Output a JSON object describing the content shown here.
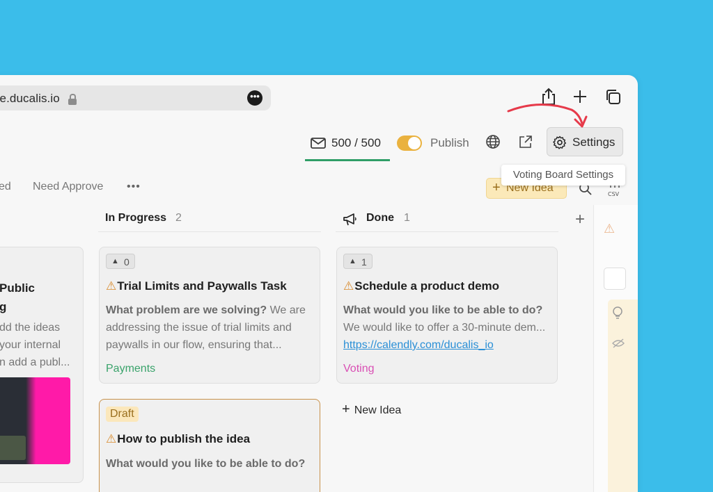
{
  "browser": {
    "url": "ge.ducalis.io",
    "menu_dots": "•••"
  },
  "toolbar": {
    "mail_count": "500 / 500",
    "publish_label": "Publish",
    "settings_label": "Settings",
    "tooltip": "Voting Board Settings"
  },
  "tabs": [
    {
      "label": "ved"
    },
    {
      "label": "Need Approve"
    }
  ],
  "tabs_more": "•••",
  "new_idea_top": "New Idea",
  "columns": {
    "left_partial": {
      "title_line1": "Public",
      "title_line2": "g",
      "desc_line1": "dd the ideas",
      "desc_line2": "your internal",
      "desc_line3": "n add a publ..."
    },
    "in_progress": {
      "title": "In Progress",
      "count": "2",
      "card1": {
        "votes": "0",
        "title": "Trial Limits and Paywalls Task",
        "desc_bold": "What problem are we solving?",
        "desc": " We are addressing the issue of trial limits and paywalls in our flow, ensuring that...",
        "tag": "Payments"
      },
      "card2": {
        "badge": "Draft",
        "title": "How to publish the idea",
        "desc_bold": "What would you like to be able to do?"
      }
    },
    "done": {
      "title": "Done",
      "count": "1",
      "card1": {
        "votes": "1",
        "title": "Schedule a product demo",
        "desc_bold": "What would you like to be able to do?",
        "desc": " We would like to offer a 30-minute dem... ",
        "link": "https://calendly.com/ducalis_io",
        "tag": "Voting"
      },
      "new_idea": "New Idea"
    }
  },
  "colors": {
    "background": "#3bbdea",
    "accent_yellow": "#eab23f",
    "green": "#2f9e67",
    "payments_tag": "#3aa36b",
    "voting_tag": "#d94fb4",
    "arrow": "#e63a4a"
  }
}
